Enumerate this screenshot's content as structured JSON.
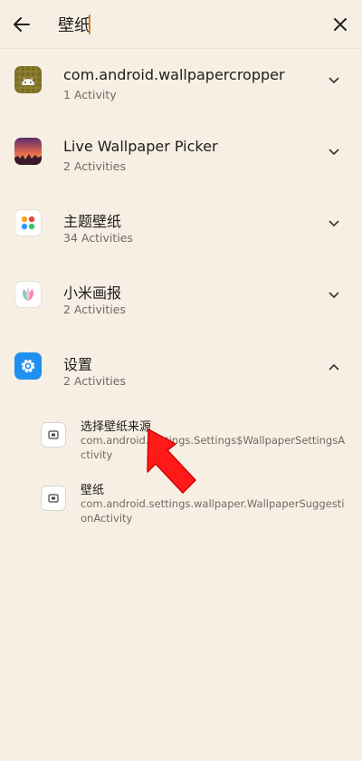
{
  "search": {
    "value": "壁纸",
    "placeholder": ""
  },
  "apps": [
    {
      "title": "com.android.wallpapercropper",
      "subtitle": "1 Activity",
      "icon": "android-icon",
      "expanded": false
    },
    {
      "title": "Live Wallpaper Picker",
      "subtitle": "2 Activities",
      "icon": "sunset-icon",
      "expanded": false
    },
    {
      "title": "主题壁纸",
      "subtitle": "34 Activities",
      "icon": "theme-icon",
      "expanded": false
    },
    {
      "title": "小米画报",
      "subtitle": "2 Activities",
      "icon": "flower-icon",
      "expanded": false
    },
    {
      "title": "设置",
      "subtitle": "2 Activities",
      "icon": "settings-gear-icon",
      "expanded": true
    }
  ],
  "activities": [
    {
      "title": "选择壁纸来源",
      "class_name": "com.android.settings.Settings$WallpaperSettingsActivity",
      "icon": "activity-icon"
    },
    {
      "title": "壁纸",
      "class_name": "com.android.settings.wallpaper.WallpaperSuggestionActivity",
      "icon": "activity-icon"
    }
  ],
  "colors": {
    "background": "#f8efe4",
    "caret": "#c9892a",
    "settings_blue": "#1f8ff0",
    "pointer_arrow": "#ff1a1a"
  }
}
